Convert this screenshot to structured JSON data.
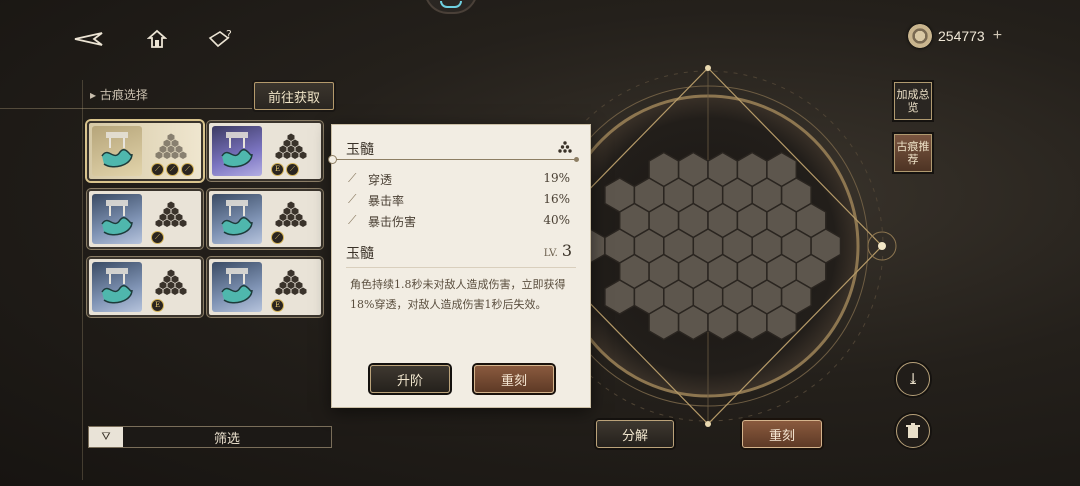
{
  "topbar": {
    "back_icon": "back-arrow-icon",
    "home_icon": "home-icon",
    "help_icon": "help-icon",
    "currency_value": "254773",
    "currency_plus": "+"
  },
  "left_panel": {
    "section_title": "古痕选择",
    "get_button": "前往获取",
    "filter_label": "筛选",
    "cards": [
      {
        "color": "gold",
        "badges": [
          "sword",
          "sword",
          "sword"
        ]
      },
      {
        "color": "purple",
        "badges": [
          "E",
          "sword"
        ]
      },
      {
        "color": "blue",
        "badges": [
          "sword"
        ]
      },
      {
        "color": "blue",
        "badges": [
          "sword"
        ]
      },
      {
        "color": "blue",
        "badges": [
          "E"
        ]
      },
      {
        "color": "blue",
        "badges": [
          "E"
        ]
      }
    ]
  },
  "popup": {
    "title": "玉髓",
    "stats": [
      {
        "name": "穿透",
        "value": "19%"
      },
      {
        "name": "暴击率",
        "value": "16%"
      },
      {
        "name": "暴击伤害",
        "value": "40%"
      }
    ],
    "sub_title": "玉髓",
    "level_label": "LV.",
    "level_value": "3",
    "description": "角色持续1.8秒未对敌人造成伤害，立即获得18%穿透，对敌人造成伤害1秒后失效。",
    "upgrade_button": "升阶",
    "reforge_button": "重刻"
  },
  "board": {
    "decompose_button": "分解",
    "reforge_button": "重刻"
  },
  "side": {
    "bonus_overview": "加成总览",
    "recommend": "古痕推荐",
    "save_icon": "save-icon",
    "delete_icon": "trash-icon"
  },
  "colors": {
    "accent_gold": "#b49a6c",
    "copper_button": "#8a5a3e",
    "panel_bg": "#f2ede3"
  }
}
